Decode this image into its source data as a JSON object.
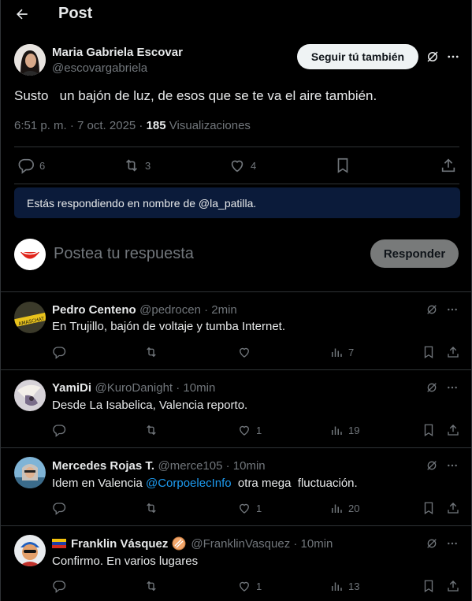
{
  "header": {
    "title": "Post"
  },
  "post": {
    "author_name": "Maria Gabriela Escovar",
    "author_handle": "@escovargabriela",
    "follow_label": "Seguir tú también",
    "text": "Susto   un bajón de luz, de esos que se te va el aire también.",
    "timestamp": "6:51 p. m. · 7 oct. 2025 · ",
    "views_count": "185",
    "views_label": " Visualizaciones",
    "replies": "6",
    "reposts": "3",
    "likes": "4"
  },
  "notice": {
    "text": "Estás respondiendo en nombre de @la_patilla."
  },
  "composer": {
    "placeholder": "Postea tu respuesta",
    "button_label": "Responder"
  },
  "replies": [
    {
      "name": "Pedro Centeno",
      "handle": "@pedrocen · 2min",
      "text": "En Trujillo, bajón de voltaje y tumba Internet.",
      "replies": "",
      "reposts": "",
      "likes": "",
      "views": "7"
    },
    {
      "name": "YamiDi",
      "handle": "@KuroDanight · 10min",
      "text": "Desde La Isabelica, Valencia reporto.",
      "replies": "",
      "reposts": "",
      "likes": "1",
      "views": "19"
    },
    {
      "name": "Mercedes Rojas T.",
      "handle": "@merce105 · 10min",
      "text_before": "Idem en Valencia ",
      "mention": "@CorpoelecInfo",
      "text_after": "  otra mega  fluctuación.",
      "replies": "",
      "reposts": "",
      "likes": "1",
      "views": "20"
    },
    {
      "name": "Franklin Vásquez",
      "handle": "@FranklinVasquez · 10min",
      "text": "Confirmo. En varios lugares",
      "replies": "",
      "reposts": "",
      "likes": "1",
      "views": "13"
    }
  ],
  "colors": {
    "background": "#000000",
    "text": "#e7e9ea",
    "muted": "#71767b",
    "accent": "#1d9bf0",
    "notice_bg": "#0b1b3a",
    "divider": "#2f3336"
  }
}
